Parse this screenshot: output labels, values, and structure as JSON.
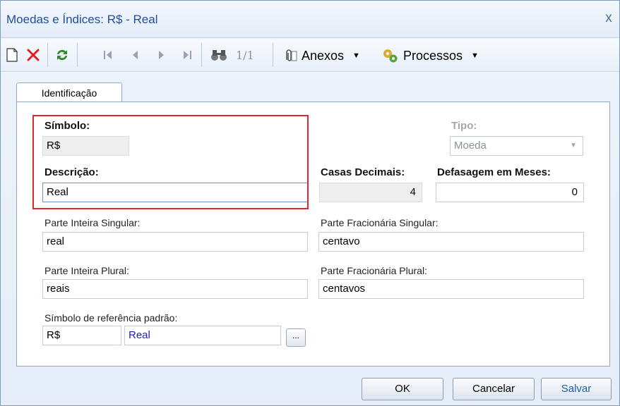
{
  "window": {
    "title": "Moedas e Índices: R$ - Real",
    "close_glyph": "x"
  },
  "toolbar": {
    "icons": [
      "new-document-icon",
      "delete-icon",
      "refresh-icon",
      "first-record-icon",
      "previous-record-icon",
      "next-record-icon",
      "last-record-icon",
      "binoculars-icon"
    ],
    "page_indicator": "1/1",
    "attachments_label": "Anexos",
    "processes_label": "Processos"
  },
  "tabs": [
    {
      "label": "Identificação",
      "active": true
    }
  ],
  "form": {
    "simbolo": {
      "label": "Símbolo:",
      "value": "R$"
    },
    "descricao": {
      "label": "Descrição:",
      "value": "Real"
    },
    "tipo": {
      "label": "Tipo:",
      "value": "Moeda"
    },
    "casas_decimais": {
      "label": "Casas Decimais:",
      "value": "4"
    },
    "defasagem": {
      "label": "Defasagem em Meses:",
      "value": "0"
    },
    "parte_inteira_singular": {
      "label": "Parte Inteira Singular:",
      "value": "real"
    },
    "parte_fracionaria_singular": {
      "label": "Parte Fracionária Singular:",
      "value": "centavo"
    },
    "parte_inteira_plural": {
      "label": "Parte Inteira Plural:",
      "value": "reais"
    },
    "parte_fracionaria_plural": {
      "label": "Parte Fracionária Plural:",
      "value": "centavos"
    },
    "simbolo_referencia": {
      "label": "Símbolo de referência padrão:",
      "code": "R$",
      "name": "Real",
      "lookup_button": "..."
    }
  },
  "footer": {
    "ok_label": "OK",
    "cancel_label": "Cancelar",
    "save_label": "Salvar"
  },
  "colors": {
    "title": "#1e4e9c",
    "highlight_box": "#e3262a",
    "delete_icon": "#e02020",
    "refresh_icon": "#2e8b2e",
    "link_text": "#2020c8"
  }
}
